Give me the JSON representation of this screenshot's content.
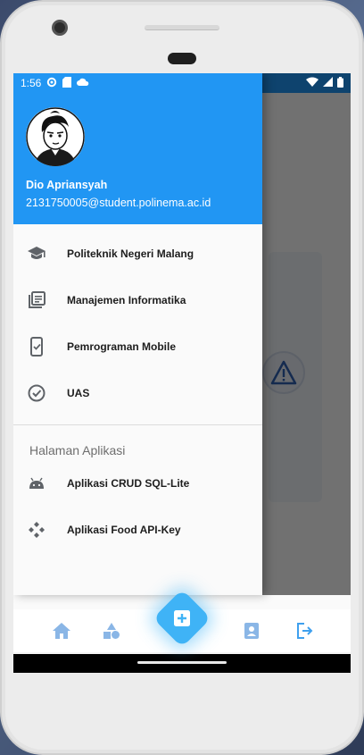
{
  "statusbar": {
    "time": "1:56"
  },
  "drawer": {
    "user_name": "Dio Apriansyah",
    "user_email": "2131750005@student.polinema.ac.id",
    "items": [
      {
        "label": "Politeknik Negeri Malang",
        "icon": "school-icon"
      },
      {
        "label": "Manajemen Informatika",
        "icon": "library-books-icon"
      },
      {
        "label": "Pemrograman Mobile",
        "icon": "mobile-check-icon"
      },
      {
        "label": "UAS",
        "icon": "check-circle-icon"
      }
    ],
    "section_title": "Halaman Aplikasi",
    "app_items": [
      {
        "label": "Aplikasi CRUD SQL-Lite",
        "icon": "android-icon"
      },
      {
        "label": "Aplikasi Food API-Key",
        "icon": "api-icon"
      }
    ]
  },
  "bottom_nav": {
    "items": [
      "home-icon",
      "category-icon",
      "add-box-icon",
      "contact-icon",
      "logout-icon"
    ]
  },
  "colors": {
    "primary": "#2196f3",
    "nav_icon": "#8ab6e6",
    "fab": "#3fb3f6"
  }
}
